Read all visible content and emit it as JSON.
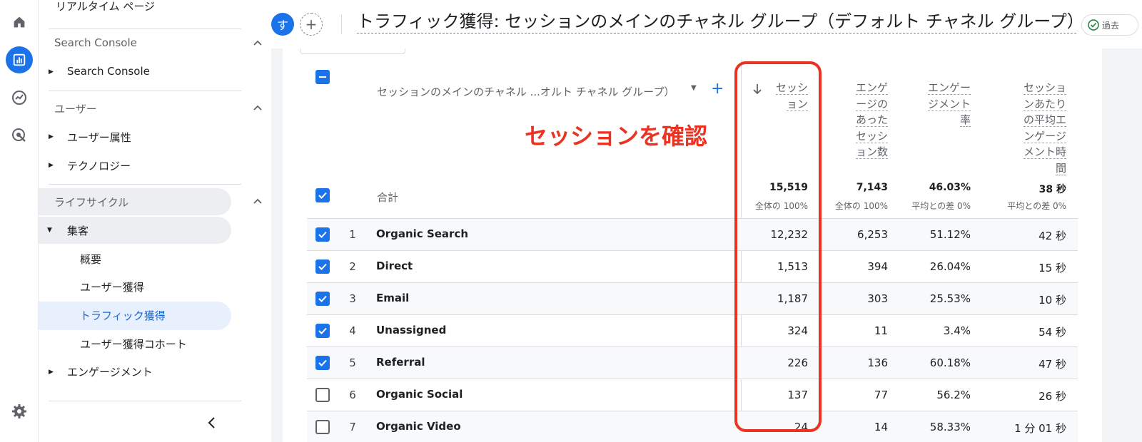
{
  "sidebar": {
    "top_item": "リアルタイム ページ",
    "sections": {
      "search_console": "Search Console",
      "user": "ユーザー",
      "lifecycle": "ライフサイクル"
    },
    "items": {
      "search_console": "Search Console",
      "user_attr": "ユーザー属性",
      "technology": "テクノロジー",
      "acquisition": "集客",
      "overview": "概要",
      "user_acq": "ユーザー獲得",
      "traffic_acq": "トラフィック獲得",
      "user_acq_cohort": "ユーザー獲得コホート",
      "engagement": "エンゲージメント"
    }
  },
  "header": {
    "avatar_letter": "す",
    "add_label": "+",
    "title": "トラフィック獲得: セッションのメインのチャネル グループ（デフォルト チャネル グループ）",
    "badge": "過去"
  },
  "table": {
    "dimension_header": "セッションのメインのチャネル ...オルト チャネル グループ）",
    "columns": [
      [
        "セッシ",
        "ョン"
      ],
      [
        "エンゲ",
        "ージの",
        "あった",
        "セッシ",
        "ョン数"
      ],
      [
        "エンゲー",
        "ジメント",
        "率"
      ],
      [
        "セッショ",
        "ンあたり",
        "の平均エ",
        "ンゲージ",
        "メント時",
        "間"
      ]
    ],
    "totals_label": "合計",
    "totals": [
      "15,519",
      "7,143",
      "46.03%",
      "38 秒"
    ],
    "totals_sub": [
      "全体の 100%",
      "全体の 100%",
      "平均との差 0%",
      "平均との差 0%"
    ],
    "rows": [
      {
        "n": "1",
        "name": "Organic Search",
        "checked": true,
        "values": [
          "12,232",
          "6,253",
          "51.12%",
          "42 秒"
        ]
      },
      {
        "n": "2",
        "name": "Direct",
        "checked": true,
        "values": [
          "1,513",
          "394",
          "26.04%",
          "15 秒"
        ]
      },
      {
        "n": "3",
        "name": "Email",
        "checked": true,
        "values": [
          "1,187",
          "303",
          "25.53%",
          "10 秒"
        ]
      },
      {
        "n": "4",
        "name": "Unassigned",
        "checked": true,
        "values": [
          "324",
          "11",
          "3.4%",
          "54 秒"
        ]
      },
      {
        "n": "5",
        "name": "Referral",
        "checked": true,
        "values": [
          "226",
          "136",
          "60.18%",
          "47 秒"
        ]
      },
      {
        "n": "6",
        "name": "Organic Social",
        "checked": false,
        "values": [
          "137",
          "77",
          "56.2%",
          "26 秒"
        ]
      },
      {
        "n": "7",
        "name": "Organic Video",
        "checked": false,
        "values": [
          "24",
          "14",
          "58.33%",
          "1 分 01 秒"
        ]
      }
    ]
  },
  "annotation": {
    "text": "セッションを確認",
    "color": "#ea3323"
  },
  "colors": {
    "accent": "#1a73e8",
    "annotation_red": "#ea3323"
  }
}
